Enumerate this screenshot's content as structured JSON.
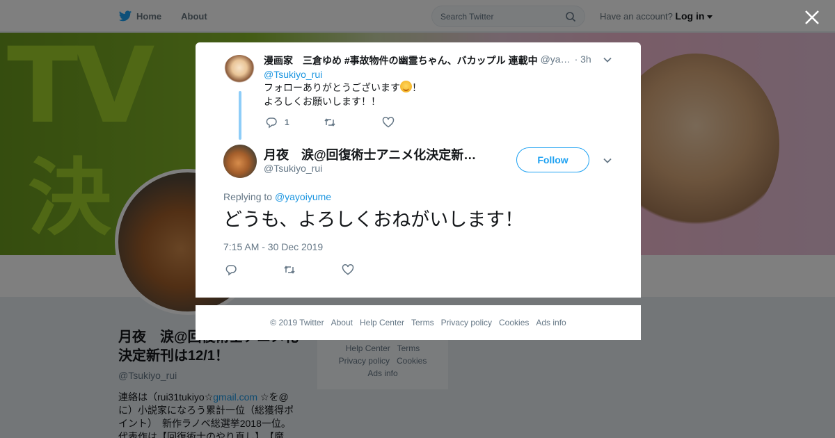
{
  "topbar": {
    "home_label": "Home",
    "about_label": "About",
    "search_placeholder": "Search Twitter",
    "have_account": "Have an account?",
    "login_label": "Log in"
  },
  "profile": {
    "name": "月夜　涙@回復術士アニメ化決定新刊は12/1！",
    "handle": "@Tsukiyo_rui",
    "bio_prefix": "連絡は（rui31tukiyo☆",
    "bio_link": "gmail.com",
    "bio_rest": " ☆を@に）小説家になろう累計一位（総獲得ポイント）　新作ラノベ総選挙2018一位。代表作は【回復術士のやり直し】、【魔"
  },
  "sidebar_footer": {
    "links": [
      "Help Center",
      "Terms",
      "Privacy policy",
      "Cookies",
      "Ads info"
    ]
  },
  "modal": {
    "parent_tweet": {
      "name": "漫画家　三倉ゆめ #事故物件の幽霊ちゃん、バカップル 連載中",
      "handle": "@ya…",
      "time": "· 3h",
      "reply_to": "@Tsukiyo_rui",
      "line1": "フォローありがとうございます",
      "line1_end": "！",
      "line2": "よろしくお願いします！！",
      "reply_count": "1"
    },
    "main_tweet": {
      "name": "月夜　涙@回復術士アニメ化決定新…",
      "handle": "@Tsukiyo_rui",
      "follow_label": "Follow",
      "replying_prefix": "Replying to",
      "replying_to": "@yayoiyume",
      "text": "どうも、よろしくおねがいします！",
      "timestamp": "7:15 AM - 30 Dec 2019"
    }
  },
  "modal_footer": {
    "copyright": "© 2019 Twitter",
    "links": [
      "About",
      "Help Center",
      "Terms",
      "Privacy policy",
      "Cookies",
      "Ads info"
    ]
  },
  "colors": {
    "twitter_blue": "#1da1f2",
    "link_blue": "#1b95e0",
    "thread_line": "#8ecdf8",
    "muted": "#657786"
  },
  "icons": [
    "twitter-bird-icon",
    "search-icon",
    "caret-down-icon",
    "close-icon",
    "chevron-down-icon",
    "reply-icon",
    "retweet-icon",
    "like-icon",
    "smiling-face-emoji"
  ]
}
